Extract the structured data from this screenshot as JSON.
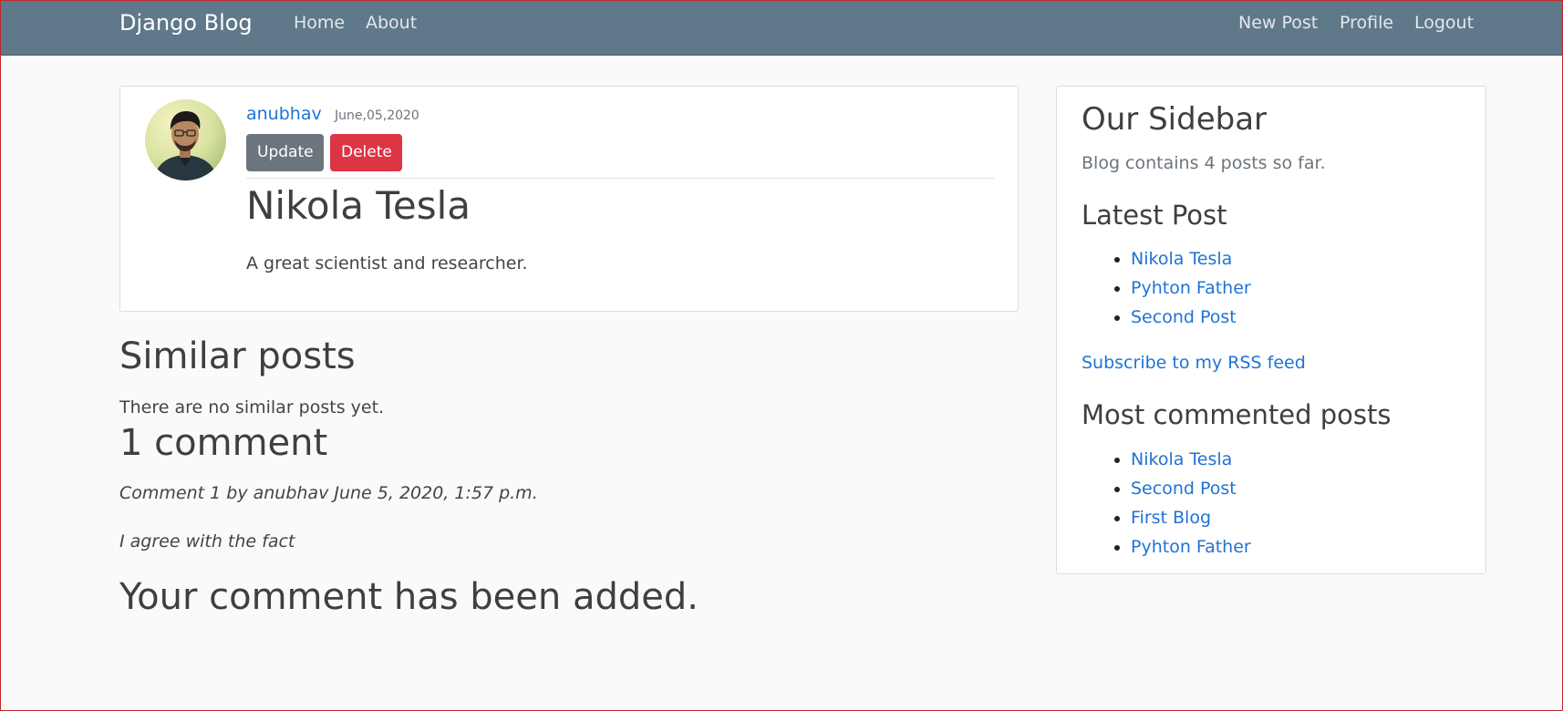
{
  "nav": {
    "brand": "Django Blog",
    "left_links": [
      "Home",
      "About"
    ],
    "right_links": [
      "New Post",
      "Profile",
      "Logout"
    ]
  },
  "post": {
    "author": "anubhav",
    "date": "June,05,2020",
    "update_label": "Update",
    "delete_label": "Delete",
    "title": "Nikola Tesla",
    "body": "A great scientist and researcher."
  },
  "similar": {
    "heading": "Similar posts",
    "text": "There are no similar posts yet."
  },
  "comments": {
    "heading": "1 comment",
    "items": [
      {
        "info": "Comment 1 by anubhav June 5, 2020, 1:57 p.m.",
        "body": "I agree with the fact"
      }
    ],
    "added_message": "Your comment has been added."
  },
  "sidebar": {
    "title": "Our Sidebar",
    "count_text": "Blog contains 4 posts so far.",
    "latest_heading": "Latest Post",
    "latest_posts": [
      "Nikola Tesla",
      "Pyhton Father",
      "Second Post"
    ],
    "rss_link": "Subscribe to my RSS feed",
    "most_commented_heading": "Most commented posts",
    "most_commented": [
      "Nikola Tesla",
      "Second Post",
      "First Blog",
      "Pyhton Father"
    ]
  },
  "colors": {
    "navbar_bg": "#5f788a",
    "link": "#1f73d6",
    "btn_secondary": "#6c757d",
    "btn_danger": "#dc3545",
    "page_bg": "#fafafa"
  },
  "icons": {
    "avatar": "user-avatar-photo"
  }
}
